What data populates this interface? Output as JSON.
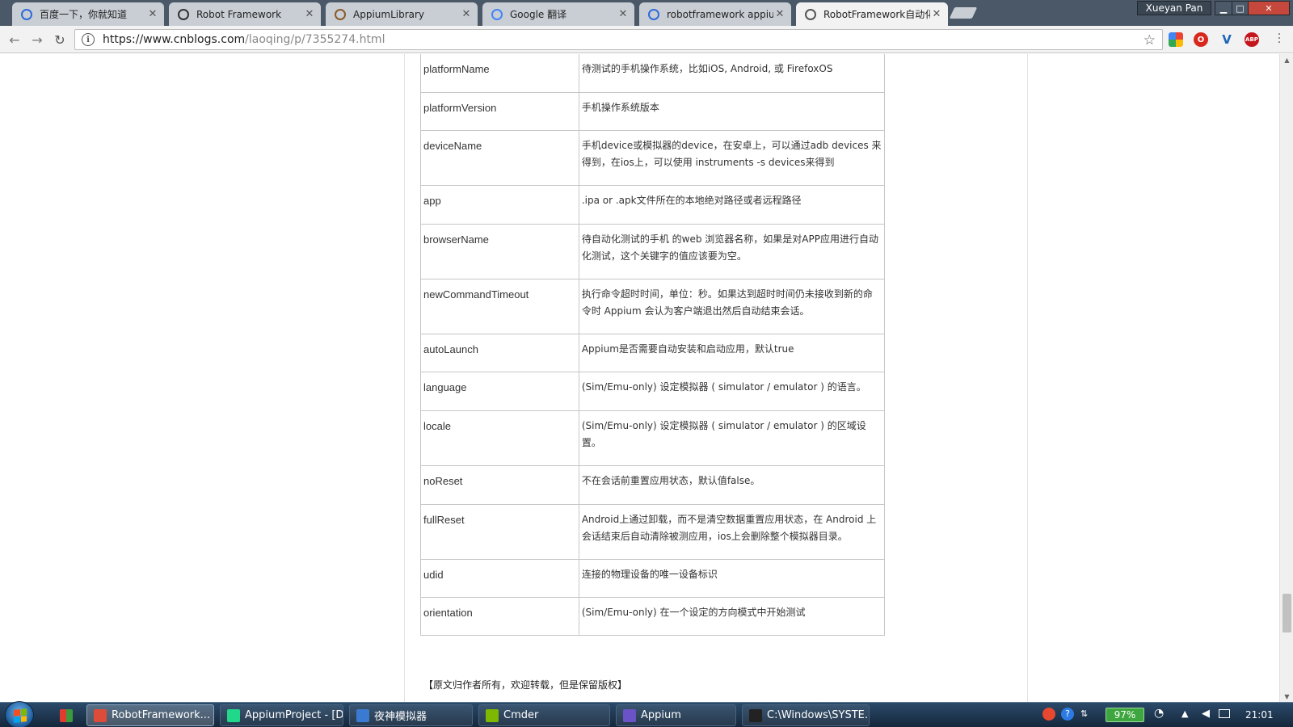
{
  "window": {
    "user": "Xueyan Pan",
    "controls": {
      "minimize": "▁",
      "maximize": "□",
      "close": "✕"
    }
  },
  "tabs": [
    {
      "title": "百度一下，你就知道",
      "icon": "baidu-icon",
      "color": "#2f6bd8"
    },
    {
      "title": "Robot Framework",
      "icon": "robot-framework-icon",
      "color": "#333333"
    },
    {
      "title": "AppiumLibrary",
      "icon": "appium-library-icon",
      "color": "#8a5a2a"
    },
    {
      "title": "Google 翻译",
      "icon": "google-translate-icon",
      "color": "#4285f4"
    },
    {
      "title": "robotframework appiu",
      "icon": "baidu-icon",
      "color": "#2f6bd8"
    },
    {
      "title": "RobotFramework自动化",
      "icon": "cnblogs-icon",
      "color": "#555555"
    }
  ],
  "toolbar": {
    "url_host": "https://www.cnblogs.com",
    "url_path": "/laoqing/p/7355274.html"
  },
  "capabilities": [
    {
      "key": "platformName",
      "desc": "待测试的手机操作系统，比如iOS, Android, 或 FirefoxOS"
    },
    {
      "key": "platformVersion",
      "desc": "手机操作系统版本"
    },
    {
      "key": "deviceName",
      "desc": "手机device或模拟器的device，在安卓上，可以通过adb devices 来得到，在ios上，可以使用 instruments -s devices来得到"
    },
    {
      "key": "app",
      "desc": ".ipa or .apk文件所在的本地绝对路径或者远程路径"
    },
    {
      "key": "browserName",
      "desc": "待自动化测试的手机 的web 浏览器名称，如果是对APP应用进行自动化测试，这个关键字的值应该要为空。"
    },
    {
      "key": "newCommandTimeout",
      "desc": "执行命令超时时间，单位：秒。如果达到超时时间仍未接收到新的命令时 Appium 会认为客户端退出然后自动结束会话。"
    },
    {
      "key": "autoLaunch",
      "desc": "Appium是否需要自动安装和启动应用，默认true"
    },
    {
      "key": "language",
      "desc": "(Sim/Emu-only) 设定模拟器 ( simulator / emulator ) 的语言。"
    },
    {
      "key": "locale",
      "desc": "(Sim/Emu-only) 设定模拟器 ( simulator / emulator ) 的区域设置。"
    },
    {
      "key": "noReset",
      "desc": "不在会话前重置应用状态，默认值false。"
    },
    {
      "key": "fullReset",
      "desc": "Android上通过卸载，而不是清空数据重置应用状态，在 Android 上会话结束后自动清除被测应用，ios上会删除整个模拟器目录。"
    },
    {
      "key": "udid",
      "desc": "连接的物理设备的唯一设备标识"
    },
    {
      "key": "orientation",
      "desc": "(Sim/Emu-only) 在一个设定的方向模式中开始测试"
    }
  ],
  "footnote": "【原文归作者所有，欢迎转载，但是保留版权】",
  "taskbar": {
    "tasks": [
      {
        "label": "RobotFramework...",
        "icon": "chrome-icon",
        "color": "#dd4b39"
      },
      {
        "label": "AppiumProject - [D...",
        "icon": "pycharm-icon",
        "color": "#21d789"
      },
      {
        "label": "夜神模拟器",
        "icon": "nox-icon",
        "color": "#3b7ad1"
      },
      {
        "label": "Cmder",
        "icon": "cmder-icon",
        "color": "#7fb800"
      },
      {
        "label": "Appium",
        "icon": "appium-icon",
        "color": "#6b52c7"
      },
      {
        "label": "C:\\Windows\\SYSTE...",
        "icon": "cmd-icon",
        "color": "#222222"
      }
    ],
    "battery": "97%",
    "time": "21:01"
  }
}
